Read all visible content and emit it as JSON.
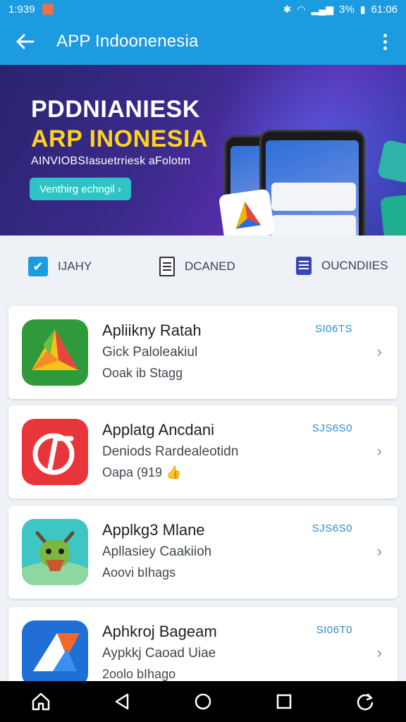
{
  "status_bar": {
    "time": "1:939",
    "battery_text": "3%",
    "clock_right": "61:06"
  },
  "app_bar": {
    "title": "APP Indoonenesia"
  },
  "banner": {
    "headline1": "PDDNIANIESK",
    "headline2": "ARP INONESIA",
    "subline": "AINVIOBSIasuetrriesk aFolotm",
    "cta": "Venthirg echngil ›",
    "dots": 3,
    "active_dot": 0
  },
  "categories": [
    {
      "label": "IJAHY",
      "icon": "chat-icon"
    },
    {
      "label": "DCANED",
      "icon": "document-icon"
    },
    {
      "label": "OUCNDIIES",
      "icon": "list-document-icon"
    }
  ],
  "apps": [
    {
      "title": "Apliikny Ratah",
      "subtitle": "Gick Paloleakiul",
      "meta": "Ooak ib Stagg",
      "size": "SI06TS",
      "icon": "origami-triangle-icon"
    },
    {
      "title": "Applatg Ancdani",
      "subtitle": "Deniods Rardealeotidn",
      "meta": "Oapa (919 👍",
      "size": "SJS6S0",
      "icon": "red-music-icon"
    },
    {
      "title": "Applkg3 Mlane",
      "subtitle": "Apllasiey Caakiioh",
      "meta": "Aoovi bIhags",
      "size": "SJS6S0",
      "icon": "android-creature-icon"
    },
    {
      "title": "Aphkroj Bageam",
      "subtitle": "Aypkkj Caoad Uiae",
      "meta": "2oolo bIhago",
      "size": "SI06T0",
      "icon": "blue-arrow-icon"
    }
  ],
  "colors": {
    "primary": "#1c9be0",
    "size_text": "#2a8fd0",
    "banner_accent": "#ffd21e",
    "cta": "#2ec4c6"
  }
}
